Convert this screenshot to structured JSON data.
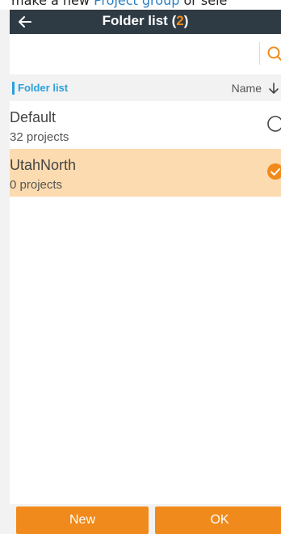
{
  "banner": {
    "text_before": "make a new ",
    "link": "Project group",
    "text_after": " or sele"
  },
  "header": {
    "title": "Folder list (",
    "count": "2",
    "title_end": ")",
    "back_icon": "arrow-left-icon"
  },
  "search": {
    "icon": "search-icon",
    "accent_color": "#f08a1c"
  },
  "list_header": {
    "label": "Folder list",
    "sort_label": "Name",
    "sort_icon": "arrow-down-icon"
  },
  "folders": [
    {
      "name": "Default",
      "subtitle": "32 projects",
      "selected": false
    },
    {
      "name": "UtahNorth",
      "subtitle": "0 projects",
      "selected": true
    }
  ],
  "buttons": {
    "new": "New",
    "ok": "OK"
  },
  "colors": {
    "accent": "#f08a1c",
    "header_bg": "#2f3b44",
    "list_label": "#2aa0dc",
    "selected_row": "#fcdbb0"
  }
}
